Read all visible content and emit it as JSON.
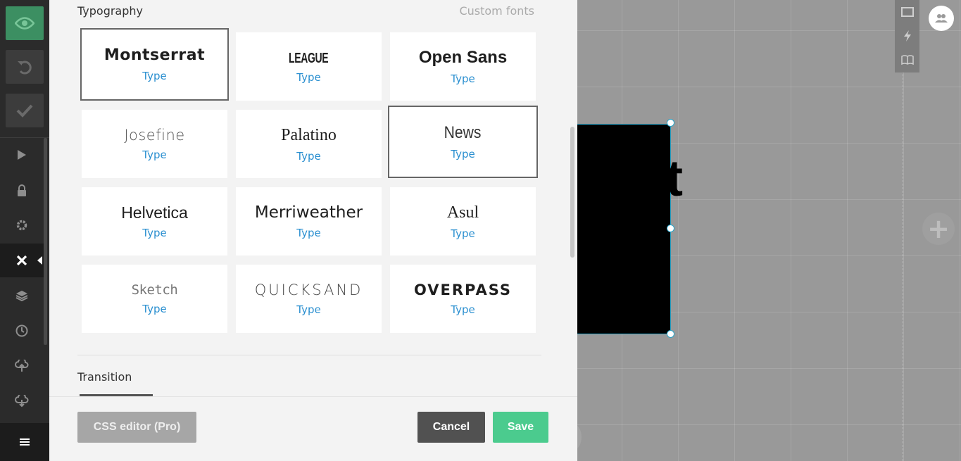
{
  "left_toolbar": {
    "top_buttons": [
      {
        "name": "preview",
        "icon": "eye-icon"
      },
      {
        "name": "undo",
        "icon": "undo-icon"
      },
      {
        "name": "publish",
        "icon": "check-icon"
      }
    ],
    "items": [
      {
        "name": "present",
        "icon": "play-icon"
      },
      {
        "name": "lock",
        "icon": "lock-icon"
      },
      {
        "name": "settings",
        "icon": "gear-icon"
      },
      {
        "name": "close-style",
        "icon": "close-icon",
        "active": true
      },
      {
        "name": "layers",
        "icon": "layers-icon"
      },
      {
        "name": "history",
        "icon": "clock-icon"
      },
      {
        "name": "import",
        "icon": "cloud-upload-icon"
      },
      {
        "name": "export",
        "icon": "cloud-download-icon"
      }
    ],
    "menu_icon": "hamburger-menu-icon"
  },
  "panel": {
    "typography_title": "Typography",
    "custom_fonts_link": "Custom fonts",
    "fonts": [
      {
        "name": "Montserrat",
        "type": "Type",
        "selected": true
      },
      {
        "name": "LEAGUE",
        "type": "Type",
        "selected": false
      },
      {
        "name": "Open Sans",
        "type": "Type",
        "selected": false
      },
      {
        "name": "Josefine",
        "type": "Type",
        "selected": false
      },
      {
        "name": "Palatino",
        "type": "Type",
        "selected": false
      },
      {
        "name": "News",
        "type": "Type",
        "selected": true
      },
      {
        "name": "Helvetica",
        "type": "Type",
        "selected": false
      },
      {
        "name": "Merriweather",
        "type": "Type",
        "selected": false
      },
      {
        "name": "Asul",
        "type": "Type",
        "selected": false
      },
      {
        "name": "Sketch",
        "type": "Type",
        "selected": false
      },
      {
        "name": "QUICKSAND",
        "type": "Type",
        "selected": false
      },
      {
        "name": "OVERPASS",
        "type": "Type",
        "selected": false
      }
    ],
    "transition_title": "Transition"
  },
  "footer": {
    "css_editor_label": "CSS editor (Pro)",
    "cancel_label": "Cancel",
    "save_label": "Save"
  },
  "canvas": {
    "slide_text_visible": "t",
    "add_slide_icon": "plus-icon",
    "right_tools": [
      "slide-icon",
      "lightning-icon",
      "book-icon"
    ],
    "collaborators_icon": "users-icon"
  },
  "colors": {
    "accent_green": "#4bcb8e",
    "preview_green": "#3c8f62",
    "link_blue": "#2a8fd0",
    "toolbar_dark": "#2b2b2b"
  }
}
